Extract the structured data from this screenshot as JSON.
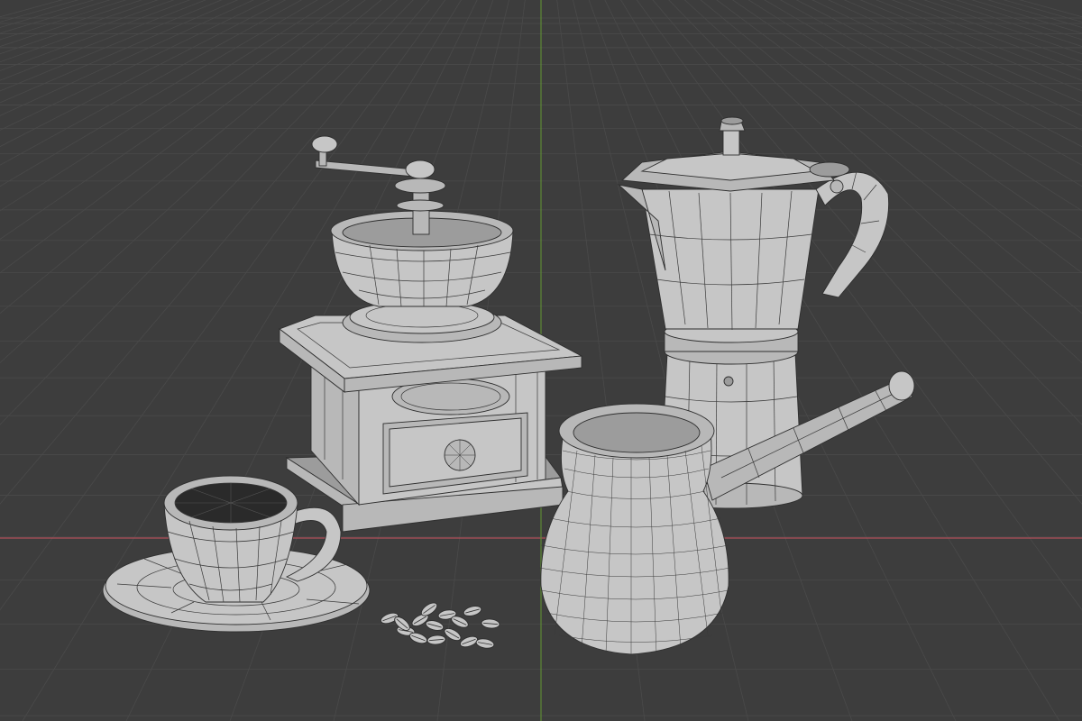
{
  "viewport": {
    "background": "#3d3d3d",
    "grid_color": "#4a4a4a",
    "x_axis_color": "#c0525a",
    "y_axis_color": "#6b9a3a",
    "display_mode": "wireframe-overlay"
  },
  "scene_objects": [
    {
      "name": "coffee-grinder",
      "icon": "grinder"
    },
    {
      "name": "moka-pot",
      "icon": "moka-pot"
    },
    {
      "name": "cezve",
      "icon": "turkish-coffee-pot"
    },
    {
      "name": "coffee-cup-with-saucer",
      "icon": "cup"
    },
    {
      "name": "coffee-beans",
      "icon": "beans"
    }
  ]
}
